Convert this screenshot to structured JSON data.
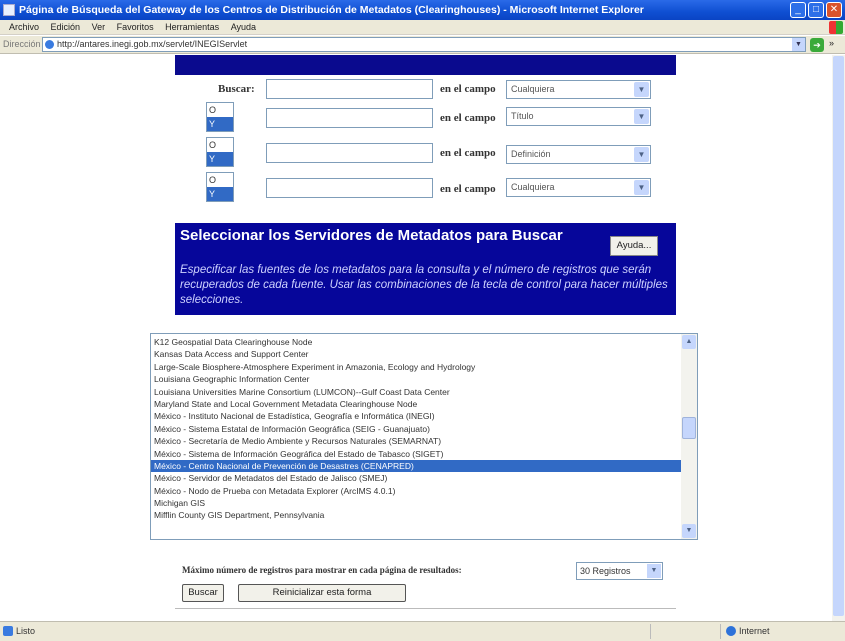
{
  "window": {
    "title": "Página de Búsqueda del Gateway de los Centros de Distribución de Metadatos (Clearinghouses) - Microsoft Internet Explorer",
    "min": "_",
    "max": "□",
    "close": "✕"
  },
  "menu": [
    "Archivo",
    "Edición",
    "Ver",
    "Favoritos",
    "Herramientas",
    "Ayuda"
  ],
  "address": {
    "label": "Dirección",
    "url": "http://antares.inegi.gob.mx/servlet/INEGIServlet",
    "go": "➔",
    "more": "»"
  },
  "search": {
    "buscar_label": "Buscar:",
    "op_or": "O",
    "op_and": "Y",
    "campo_label": "en el campo",
    "rows": [
      {
        "field": "Cualquiera",
        "has_op": false
      },
      {
        "field": "Título",
        "has_op": true
      },
      {
        "field": "Definición",
        "has_op": true
      },
      {
        "field": "Cualquiera",
        "has_op": true
      }
    ]
  },
  "panel": {
    "heading": "Seleccionar los Servidores de Metadatos para Buscar",
    "help_button": "Ayuda...",
    "description": "Especificar las fuentes de los metadatos para la consulta y el número de registros que serán recuperados de cada fuente. Usar las combinaciones de la tecla de control para hacer múltiples selecciones."
  },
  "servers": [
    "K12 Geospatial Data Clearinghouse Node",
    "Kansas Data Access and Support Center",
    "Large-Scale Biosphere-Atmosphere Experiment in Amazonia, Ecology and Hydrology",
    "Louisiana Geographic Information Center",
    "Louisiana Universities Marine Consortium (LUMCON)--Gulf Coast Data Center",
    "Maryland State and Local Government Metadata Clearinghouse Node",
    "México - Instituto Nacional de Estadística, Geografía e Informática (INEGI)",
    "México - Sistema Estatal de Información Geográfica (SEIG - Guanajuato)",
    "México - Secretaría de Medio Ambiente y Recursos Naturales (SEMARNAT)",
    "México - Sistema de Información Geográfica del Estado de Tabasco (SIGET)",
    "México - Centro Nacional de Prevención de Desastres (CENAPRED)",
    "México - Servidor de Metadatos del Estado de Jalisco (SMEJ)",
    "México - Nodo de Prueba con Metadata Explorer (ArcIMS 4.0.1)",
    "Michigan GIS",
    "Mifflin County GIS Department, Pennsylvania"
  ],
  "selected_server_index": 10,
  "results": {
    "label": "Máximo número de registros para mostrar en cada página de resultados:",
    "value": "30 Registros",
    "buscar_button": "Buscar",
    "reset_button": "Reinicializar esta forma"
  },
  "status": {
    "text": "Listo",
    "zone": "Internet"
  }
}
